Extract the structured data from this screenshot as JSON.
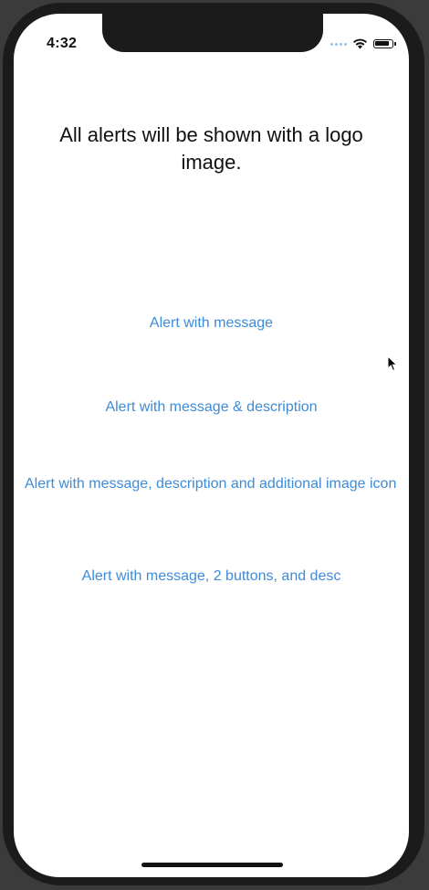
{
  "status_bar": {
    "time": "4:32",
    "signal_icon": "cellular-dots-icon",
    "wifi_icon": "wifi-icon",
    "battery_icon": "battery-icon"
  },
  "main": {
    "heading": "All alerts will be shown with a logo image.",
    "links": [
      {
        "label": "Alert with message"
      },
      {
        "label": "Alert with message & description"
      },
      {
        "label": "Alert with message, description and additional image icon"
      },
      {
        "label": "Alert with message, 2 buttons, and desc"
      }
    ]
  },
  "colors": {
    "link": "#3d8bd9",
    "background": "#ffffff",
    "frame": "#3b3b3b"
  }
}
